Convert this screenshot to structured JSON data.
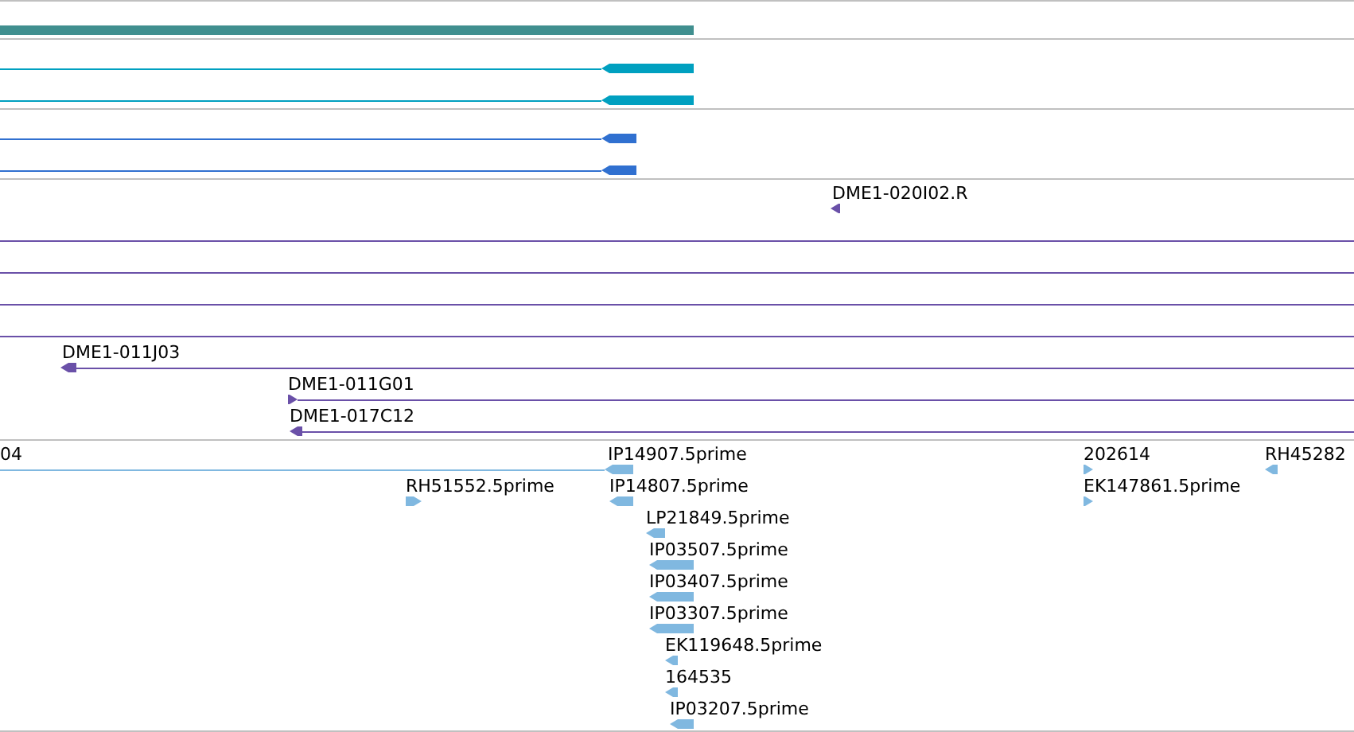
{
  "tracks": [
    {
      "color": "#408f8f",
      "features": [
        {
          "kind": "block"
        }
      ]
    },
    {
      "color": "#00a0c0",
      "features": [
        {
          "kind": "left"
        },
        {
          "kind": "left"
        }
      ]
    },
    {
      "color": "#3070d0",
      "features": [
        {
          "kind": "left"
        },
        {
          "kind": "left"
        }
      ]
    },
    {
      "color": "#6a50a8",
      "features": [
        {
          "kind": "left",
          "label": "DME1-020I02.R"
        },
        {
          "kind": "line"
        },
        {
          "kind": "line"
        },
        {
          "kind": "line"
        },
        {
          "kind": "line"
        },
        {
          "kind": "left",
          "label": "DME1-011J03"
        },
        {
          "kind": "right",
          "label": "DME1-011G01"
        },
        {
          "kind": "left",
          "label": "DME1-017C12"
        }
      ]
    },
    {
      "color": "#80b8e0",
      "features": [
        {
          "kind": "line",
          "label": "04"
        },
        {
          "kind": "left",
          "label": "IP14907.5prime"
        },
        {
          "kind": "right",
          "label": "RH51552.5prime"
        },
        {
          "kind": "left",
          "label": "IP14807.5prime"
        },
        {
          "kind": "left",
          "label": "LP21849.5prime"
        },
        {
          "kind": "left",
          "label": "IP03507.5prime"
        },
        {
          "kind": "left",
          "label": "IP03407.5prime"
        },
        {
          "kind": "left",
          "label": "IP03307.5prime"
        },
        {
          "kind": "left",
          "label": "EK119648.5prime"
        },
        {
          "kind": "left",
          "label": "164535"
        },
        {
          "kind": "left",
          "label": "IP03207.5prime"
        },
        {
          "kind": "right",
          "label": "202614"
        },
        {
          "kind": "right",
          "label": "EK147861.5prime"
        },
        {
          "kind": "left",
          "label": "RH45282"
        }
      ]
    }
  ]
}
